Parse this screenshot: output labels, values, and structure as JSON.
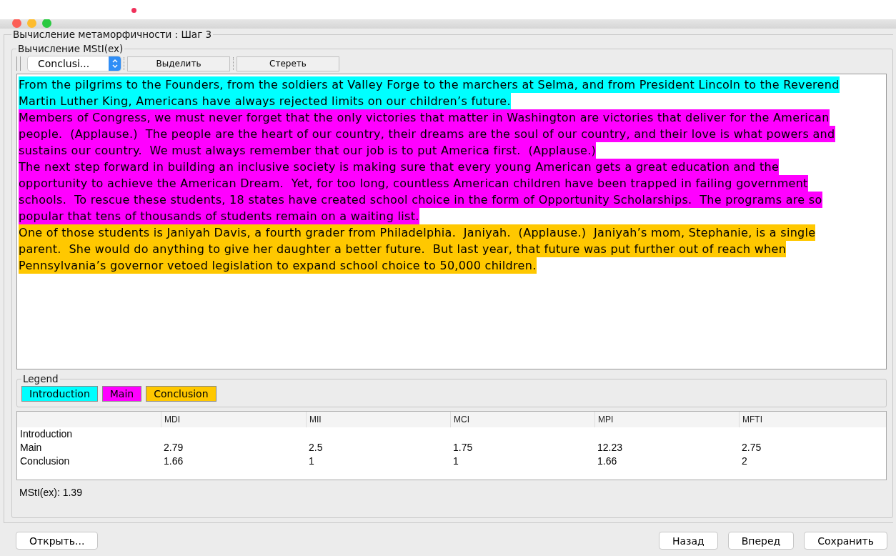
{
  "window": {
    "title": "Вычисление метаморфичности : Шаг 3"
  },
  "panel": {
    "title": "Вычисление MStI(ex)"
  },
  "toolbar": {
    "dropdown": {
      "value": "Conclusi..."
    },
    "buttons": [
      "Выделить",
      "Стереть"
    ]
  },
  "text_segments": [
    {
      "lines": [
        "From the pilgrims to the Founders, from the soldiers at Valley Forge to the marchers at Selma, and from President Lincoln to the Reverend",
        "Martin Luther King, Americans have always rejected limits on our children’s future."
      ],
      "color": "#00ffff"
    },
    {
      "lines": [
        "Members of Congress, we must never forget that the only victories that matter in Washington are victories that deliver for the American",
        "people.  (Applause.)  The people are the heart of our country, their dreams are the soul of our country, and their love is what powers and",
        "sustains our country.  We must always remember that our job is to put America first.  (Applause.)"
      ],
      "color": "#ff00ff"
    },
    {
      "lines": [
        "The next step forward in building an inclusive society is making sure that every young American gets a great education and the",
        "opportunity to achieve the American Dream.  Yet, for too long, countless American children have been trapped in failing government",
        "schools.  To rescue these students, 18 states have created school choice in the form of Opportunity Scholarships.  The programs are so",
        "popular that tens of thousands of students remain on a waiting list."
      ],
      "color": "#ff00ff"
    },
    {
      "lines": [
        "One of those students is Janiyah Davis, a fourth grader from Philadelphia.  Janiyah.  (Applause.)  Janiyah’s mom, Stephanie, is a single",
        "parent.  She would do anything to give her daughter a better future.  But last year, that future was put further out of reach when",
        "Pennsylvania’s governor vetoed legislation to expand school choice to 50,000 children."
      ],
      "color": "#ffc800"
    }
  ],
  "legend": {
    "title": "Legend",
    "items": [
      {
        "label": "Introduction",
        "color": "#00ffff"
      },
      {
        "label": "Main",
        "color": "#ff00ff"
      },
      {
        "label": "Conclusion",
        "color": "#ffc800"
      }
    ]
  },
  "table": {
    "columns": [
      "MDI",
      "MII",
      "MCI",
      "MPI",
      "MFTI"
    ],
    "rows": [
      {
        "label": "Introduction",
        "cells": []
      },
      {
        "label": "Main",
        "cells": [
          "2.79",
          "2.5",
          "1.75",
          "12.23",
          "2.75"
        ]
      },
      {
        "label": "Conclusion",
        "cells": [
          "1.66",
          "1",
          "1",
          "1.66",
          "2"
        ]
      }
    ]
  },
  "result": "MStI(ex): 1.39",
  "footer": {
    "left_button": "Открыть...",
    "right_buttons": [
      "Назад",
      "Вперед",
      "Сохранить"
    ]
  }
}
